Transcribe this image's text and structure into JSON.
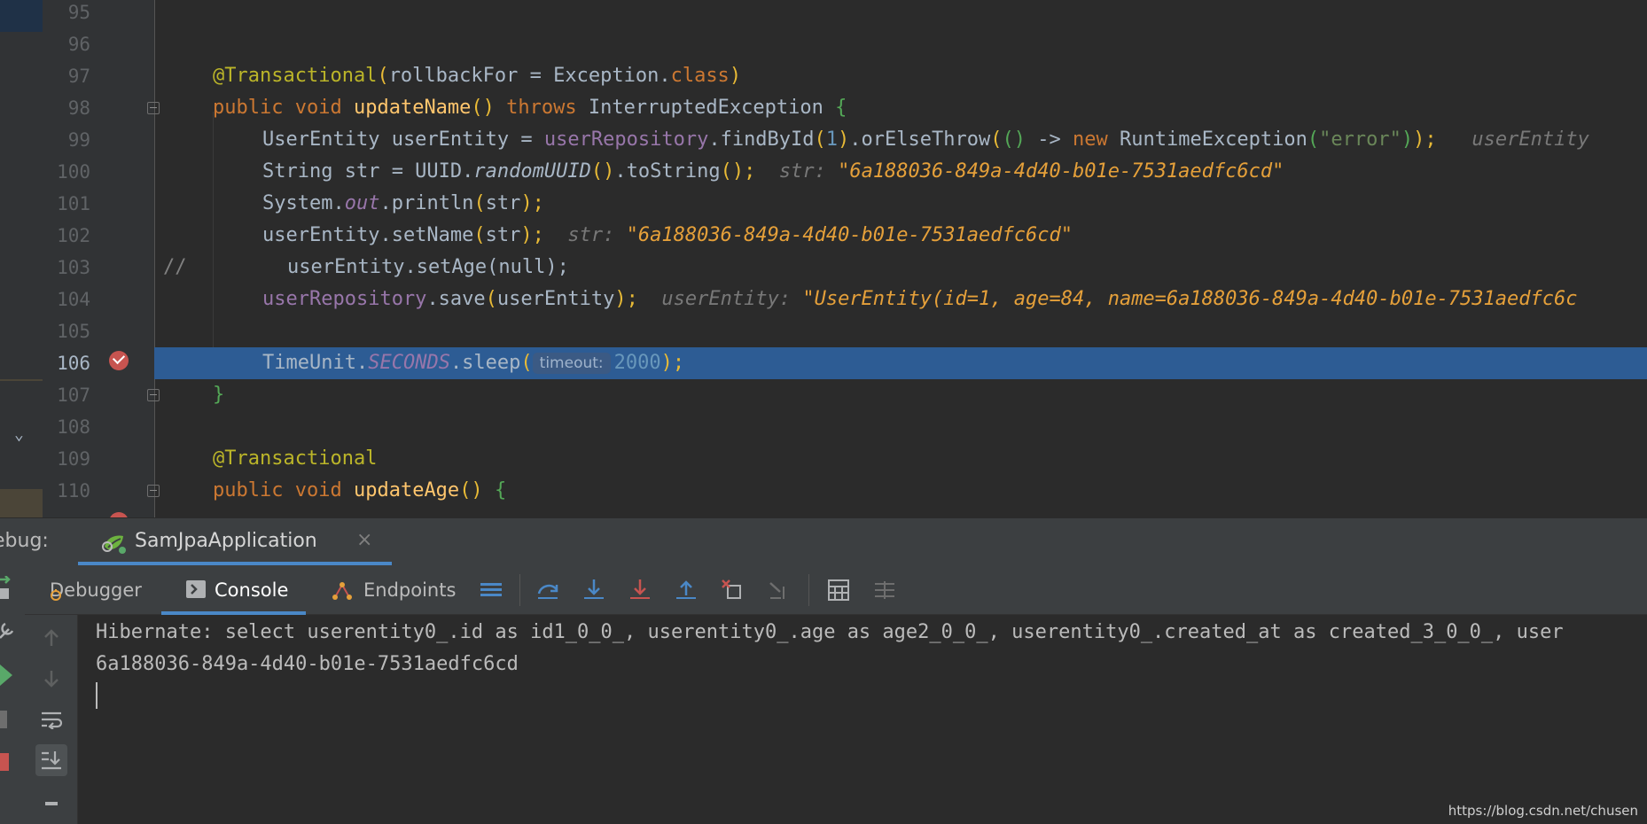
{
  "editor": {
    "lines": [
      {
        "num": "95"
      },
      {
        "num": "96"
      },
      {
        "num": "97",
        "t": {
          "ann": "@Transactional",
          "p1": "(",
          "arg": "rollbackFor = Exception.",
          "kw": "class",
          "p2": ")"
        }
      },
      {
        "num": "98",
        "t": {
          "kw1": "public",
          "kw2": "void",
          "fn": "updateName",
          "paren": "()",
          "kw3": "throws",
          "exc": "InterruptedException",
          "brace": "{"
        }
      },
      {
        "num": "99",
        "t": {
          "a": "UserEntity userEntity = ",
          "field": "userRepository",
          "b": ".findById",
          "p1": "(",
          "n": "1",
          "p2": ")",
          "c": ".orElseThrow",
          "p3": "(",
          "lam": "()",
          "d": " -> ",
          "kw": "new",
          "e": " RuntimeException",
          "p4": "(",
          "s": "\"error\"",
          "p5": ")",
          "p6": ");",
          "inl": "userEntity"
        }
      },
      {
        "num": "100",
        "t": {
          "a": "String str = UUID.",
          "ital": "randomUUID",
          "p1": "()",
          "b": ".toString",
          "p2": "();",
          "inl": "str:",
          "val": "\"6a188036-849a-4d40-b01e-7531aedfc6cd\""
        }
      },
      {
        "num": "101",
        "t": {
          "a": "System.",
          "stat": "out",
          "b": ".println",
          "p1": "(",
          "c": "str",
          "p2": ");"
        }
      },
      {
        "num": "102",
        "t": {
          "a": "userEntity.setName",
          "p1": "(",
          "c": "str",
          "p2": ");",
          "inl": "str:",
          "val": "\"6a188036-849a-4d40-b01e-7531aedfc6cd\""
        }
      },
      {
        "num": "103",
        "t": {
          "cmt": "//",
          "code": "userEntity.setAge(null);"
        }
      },
      {
        "num": "104",
        "t": {
          "field": "userRepository",
          "a": ".save",
          "p1": "(",
          "c": "userEntity",
          "p2": ");",
          "inl": "userEntity:",
          "val": "\"UserEntity(id=1, age=84, name=6a188036-849a-4d40-b01e-7531aedfc6c"
        }
      },
      {
        "num": "105"
      },
      {
        "num": "106",
        "t": {
          "a": "TimeUnit.",
          "stat": "SECONDS",
          "b": ".sleep",
          "p1": "(",
          "hint": "timeout:",
          "n": "2000",
          "p2": ");"
        }
      },
      {
        "num": "107",
        "t": {
          "brace": "}"
        }
      },
      {
        "num": "108"
      },
      {
        "num": "109",
        "t": {
          "ann": "@Transactional"
        }
      },
      {
        "num": "110",
        "t": {
          "kw1": "public",
          "kw2": "void",
          "fn": "updateAge",
          "paren": "()",
          "brace": "{"
        }
      }
    ]
  },
  "debug": {
    "label": "ebug:",
    "tab_title": "SamJpaApplication",
    "tab_close": "×",
    "toolbar": {
      "debugger": "Debugger",
      "console": "Console",
      "endpoints": "Endpoints"
    }
  },
  "console": {
    "lines": [
      "Hibernate: select userentity0_.id as id1_0_0_, userentity0_.age as age2_0_0_, userentity0_.created_at as created_3_0_0_, user",
      "6a188036-849a-4d40-b01e-7531aedfc6cd"
    ]
  },
  "watermark": "https://blog.csdn.net/chusen",
  "colors": {
    "accent": "#4a88c7",
    "current_line": "#2d5c94",
    "breakpoint": "#c75450"
  }
}
